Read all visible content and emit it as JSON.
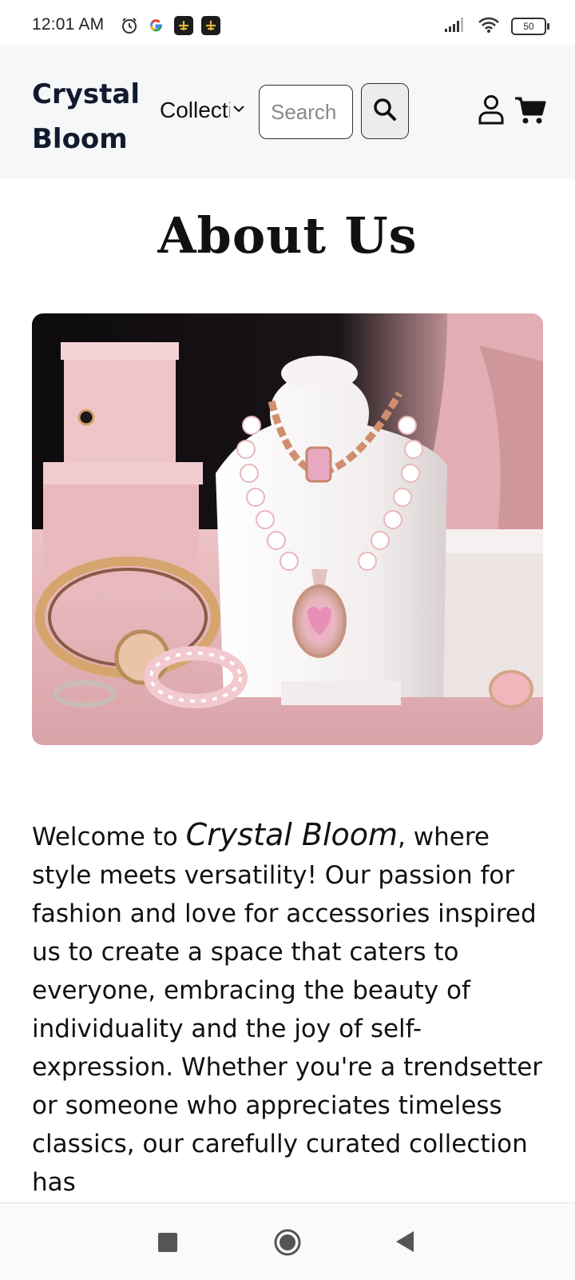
{
  "status_bar": {
    "time": "12:01 AM",
    "battery": "50",
    "icons_left": [
      "alarm-icon",
      "google-icon",
      "app-icon",
      "app-icon"
    ],
    "icons_right": [
      "signal-icon",
      "wifi-icon",
      "battery-icon"
    ]
  },
  "header": {
    "logo": "Crystal Bloom",
    "collections_label": "Collections",
    "search_placeholder": "Search",
    "icons": [
      "search-icon",
      "account-icon",
      "cart-icon"
    ]
  },
  "page": {
    "title": "About Us",
    "intro_prefix": "Welcome to ",
    "intro_brand": "Crystal Bloom",
    "intro_suffix": ", where style meets versatility! Our passion for fashion and love for accessories inspired us to create a space that caters to everyone, embracing the beauty of individuality and the joy of self-expression. Whether you're a trendsetter or someone who appreciates timeless classics, our carefully curated collection has"
  },
  "colors": {
    "header_bg": "#f6f7f9",
    "logo": "#111a2e",
    "hero_pink": "#e8b9bd"
  },
  "nav": {
    "icons": [
      "recents-icon",
      "home-icon",
      "back-icon"
    ]
  }
}
